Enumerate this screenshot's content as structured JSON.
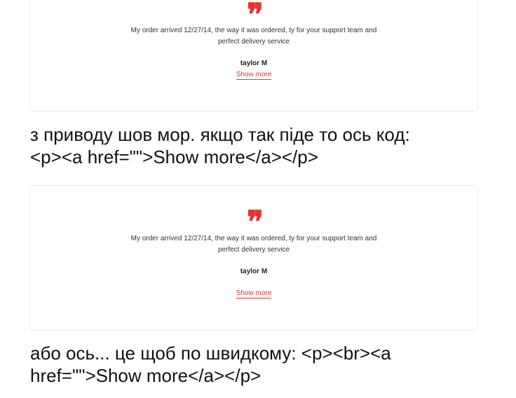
{
  "cards": [
    {
      "quote_icon": "❞",
      "quote_line1": "My order arrived 12/27/14, the way it was ordered, ty for your support team and",
      "quote_line2": "perfect delivery service",
      "author": "taylor M",
      "link": "Show more"
    },
    {
      "quote_icon": "❞",
      "quote_line1": "My order arrived 12/27/14, the way it was ordered, ty for your support team and",
      "quote_line2": "perfect delivery service",
      "author": "taylor M",
      "link": "Show more"
    }
  ],
  "messages": [
    {
      "line1": "з приводу шов мор. якщо так піде то ось код:",
      "line2": "<p><a href=\"\">Show more</a></p>"
    },
    {
      "line1": "або ось... це щоб по швидкому: <p><br><a",
      "line2": "href=\"\">Show more</a></p>"
    }
  ],
  "colors": {
    "accent": "#e8322d",
    "text": "#111111"
  },
  "icons": [
    "quote-icon"
  ]
}
